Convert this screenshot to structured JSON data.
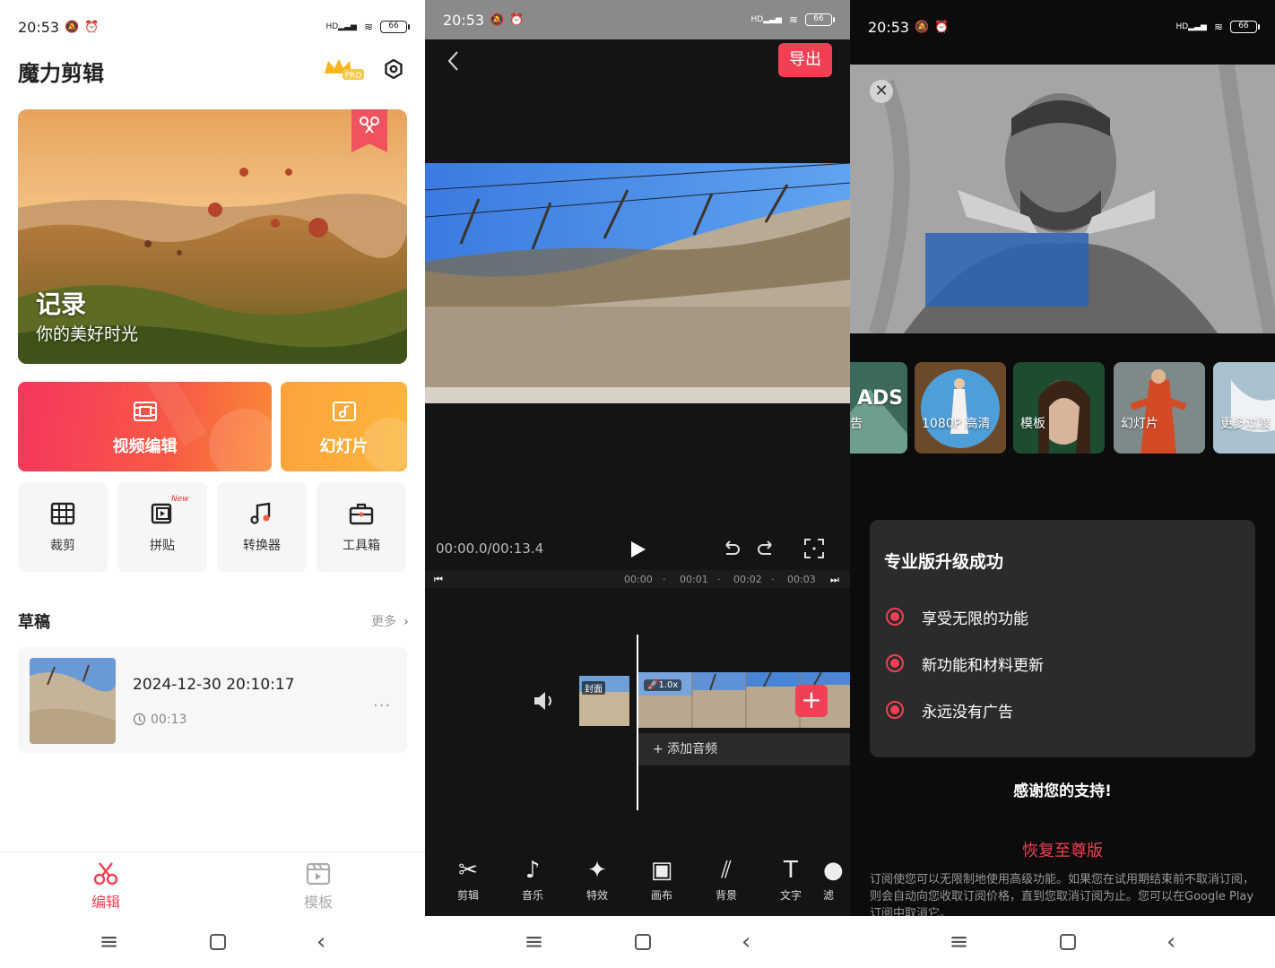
{
  "status": {
    "time": "20:53",
    "battery": "66",
    "network": "HD"
  },
  "home": {
    "app_title": "魔力剪辑",
    "pro_label": "PRO",
    "hero": {
      "title": "记录",
      "subtitle": "你的美好时光"
    },
    "video_edit_label": "视频编辑",
    "slideshow_label": "幻灯片",
    "tools": [
      {
        "label": "裁剪",
        "icon": "crop-icon"
      },
      {
        "label": "拼贴",
        "icon": "collage-icon",
        "badge": "New"
      },
      {
        "label": "转换器",
        "icon": "music-convert-icon"
      },
      {
        "label": "工具箱",
        "icon": "toolbox-icon"
      }
    ],
    "drafts_title": "草稿",
    "more_label": "更多",
    "draft": {
      "date": "2024-12-30 20:10:17",
      "duration": "00:13",
      "menu": "..."
    },
    "tabs": [
      {
        "label": "编辑",
        "active": true
      },
      {
        "label": "模板",
        "active": false
      }
    ]
  },
  "editor": {
    "export_label": "导出",
    "timecode": "00:00.0/00:13.4",
    "ruler": [
      "00:00",
      "00:01",
      "00:02",
      "00:03"
    ],
    "cover_label": "封面",
    "speed_label": "1.0x",
    "add_audio_label": "+ 添加音频",
    "tools": [
      {
        "label": "剪辑",
        "icon": "scissors-icon"
      },
      {
        "label": "音乐",
        "icon": "music-note-icon"
      },
      {
        "label": "特效",
        "icon": "sparkle-icon"
      },
      {
        "label": "画布",
        "icon": "canvas-icon"
      },
      {
        "label": "背景",
        "icon": "background-icon"
      },
      {
        "label": "文字",
        "icon": "text-icon"
      },
      {
        "label": "滤",
        "icon": "filter-icon"
      }
    ]
  },
  "upgrade": {
    "features": [
      {
        "label": "ADS",
        "sub": "告"
      },
      {
        "label": "1080P 高清"
      },
      {
        "label": "模板"
      },
      {
        "label": "幻灯片"
      },
      {
        "label": "更多过渡"
      }
    ],
    "card_title": "专业版升级成功",
    "benefits": [
      "享受无限的功能",
      "新功能和材料更新",
      "永远没有广告"
    ],
    "thanks": "感谢您的支持!",
    "restore": "恢复至尊版",
    "fine_print": "订阅使您可以无限制地使用高级功能。如果您在试用期结束前不取消订阅，则会自动向您收取订阅价格，直到您取消订阅为止。您可以在Google Play订阅中取消它。"
  },
  "colors": {
    "accent": "#f33f54",
    "orange": "#fca33a",
    "dark": "#141414"
  }
}
